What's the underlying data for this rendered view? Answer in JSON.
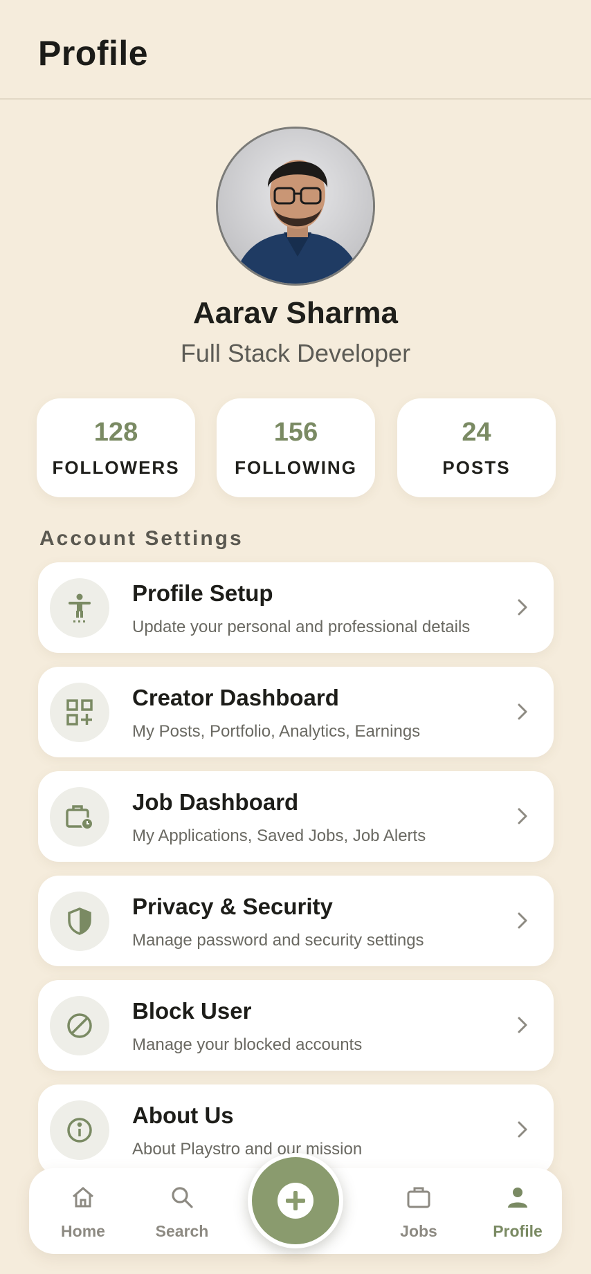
{
  "header": {
    "title": "Profile"
  },
  "profile": {
    "name": "Aarav Sharma",
    "role": "Full Stack Developer"
  },
  "stats": [
    {
      "value": "128",
      "label": "FOLLOWERS"
    },
    {
      "value": "156",
      "label": "FOLLOWING"
    },
    {
      "value": "24",
      "label": "POSTS"
    }
  ],
  "settings": {
    "title": "Account Settings",
    "items": [
      {
        "title": "Profile Setup",
        "subtitle": "Update your personal and professional details",
        "icon": "person-setup-icon"
      },
      {
        "title": "Creator Dashboard",
        "subtitle": "My Posts, Portfolio, Analytics, Earnings",
        "icon": "dashboard-grid-icon"
      },
      {
        "title": "Job Dashboard",
        "subtitle": "My Applications, Saved Jobs, Job Alerts",
        "icon": "briefcase-clock-icon"
      },
      {
        "title": "Privacy & Security",
        "subtitle": "Manage password and security settings",
        "icon": "shield-icon"
      },
      {
        "title": "Block User",
        "subtitle": "Manage your blocked accounts",
        "icon": "block-icon"
      },
      {
        "title": "About Us",
        "subtitle": "About Playstro and our mission",
        "icon": "info-icon"
      }
    ]
  },
  "nav": {
    "items": [
      {
        "label": "Home",
        "icon": "home-icon"
      },
      {
        "label": "Search",
        "icon": "search-icon"
      },
      {
        "label": "Jobs",
        "icon": "briefcase-icon"
      },
      {
        "label": "Profile",
        "icon": "person-icon",
        "active": true
      }
    ],
    "fab_icon": "plus-icon"
  },
  "colors": {
    "background": "#f5ecdc",
    "accent": "#8a9b6e",
    "accent_text": "#7a8a63",
    "card": "#ffffff"
  }
}
